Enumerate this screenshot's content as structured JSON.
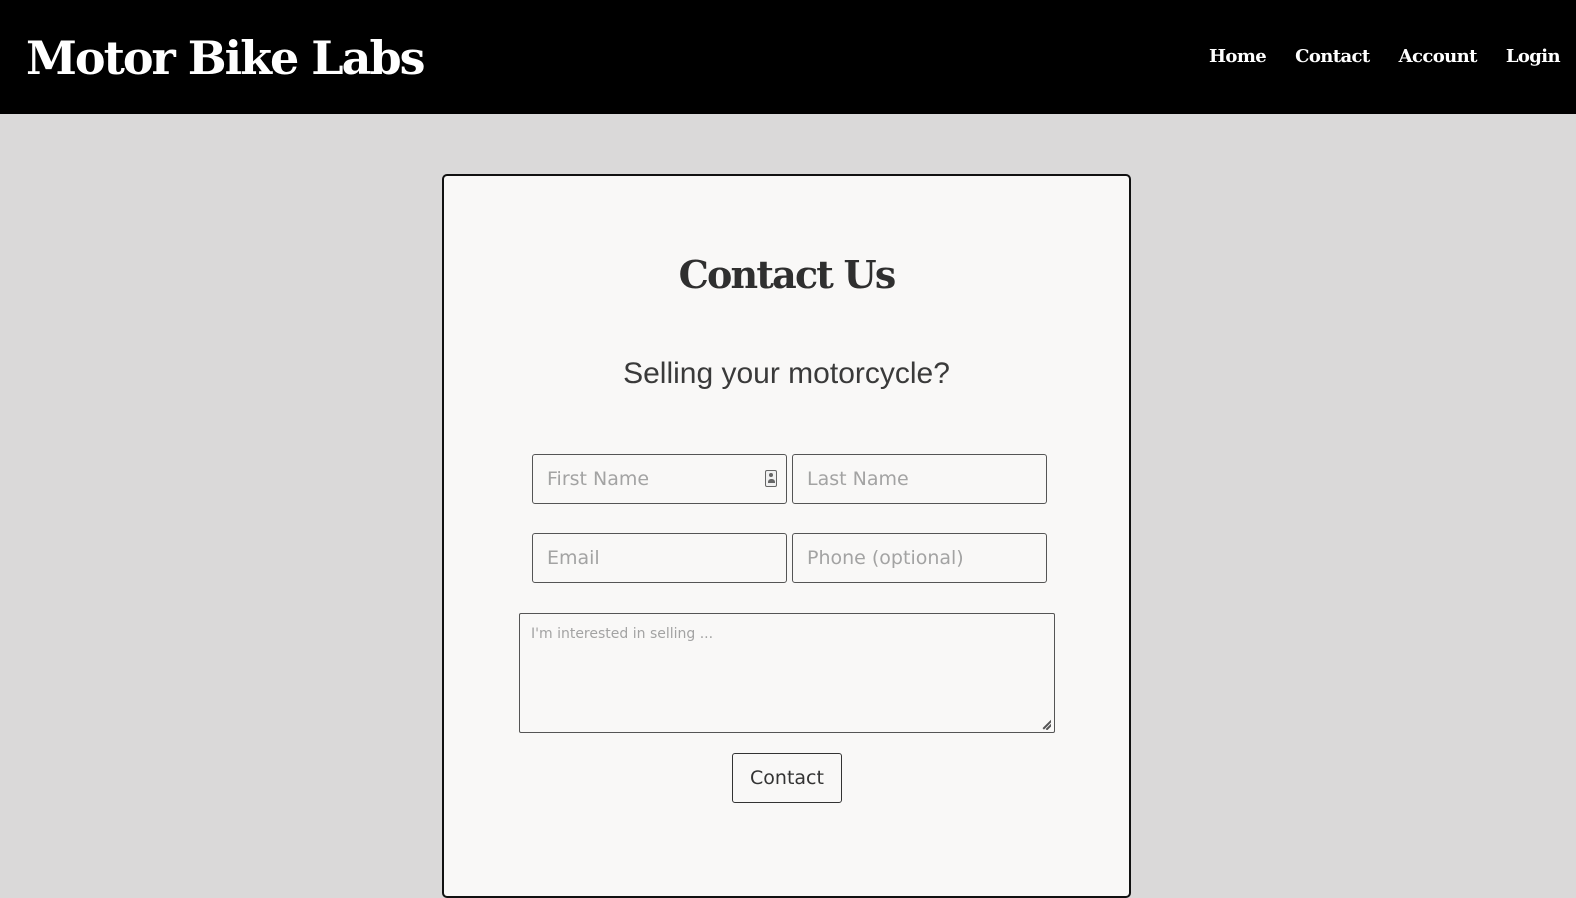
{
  "header": {
    "brand": "Motor Bike Labs",
    "nav": [
      "Home",
      "Contact",
      "Account",
      "Login"
    ]
  },
  "contact_form": {
    "title": "Contact Us",
    "subtitle": "Selling your motorcycle?",
    "first_name_placeholder": "First Name",
    "last_name_placeholder": "Last Name",
    "email_placeholder": "Email",
    "phone_placeholder": "Phone (optional)",
    "message_placeholder": "I'm interested in selling ...",
    "submit_label": "Contact"
  },
  "colors": {
    "header_bg": "#000000",
    "page_bg": "#dad9d9",
    "card_bg": "#f9f8f7",
    "text": "#333333"
  }
}
